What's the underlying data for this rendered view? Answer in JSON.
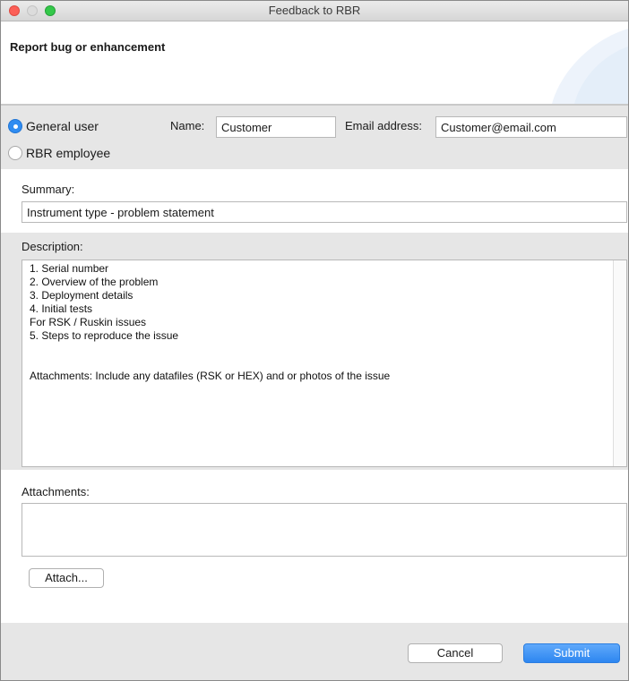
{
  "window": {
    "title": "Feedback to RBR"
  },
  "banner": {
    "heading": "Report bug or enhancement"
  },
  "user_type": {
    "options": [
      {
        "label": "General user",
        "selected": true
      },
      {
        "label": "RBR employee",
        "selected": false
      }
    ]
  },
  "contact": {
    "name_label": "Name:",
    "name_value": "Customer",
    "email_label": "Email address:",
    "email_value": "Customer@email.com"
  },
  "summary": {
    "label": "Summary:",
    "value": "Instrument type - problem statement"
  },
  "description": {
    "label": "Description:",
    "text": "1. Serial number\n2. Overview of the problem\n3. Deployment details\n4. Initial tests\nFor RSK / Ruskin issues\n5. Steps to reproduce the issue\n\n\nAttachments: Include any datafiles (RSK or HEX) and or photos of the issue"
  },
  "attachments": {
    "label": "Attachments:",
    "attach_button": "Attach..."
  },
  "footer": {
    "cancel_button": "Cancel",
    "submit_button": "Submit"
  },
  "colors": {
    "accent": "#2f8cf1",
    "panel_gray": "#e6e6e6"
  }
}
